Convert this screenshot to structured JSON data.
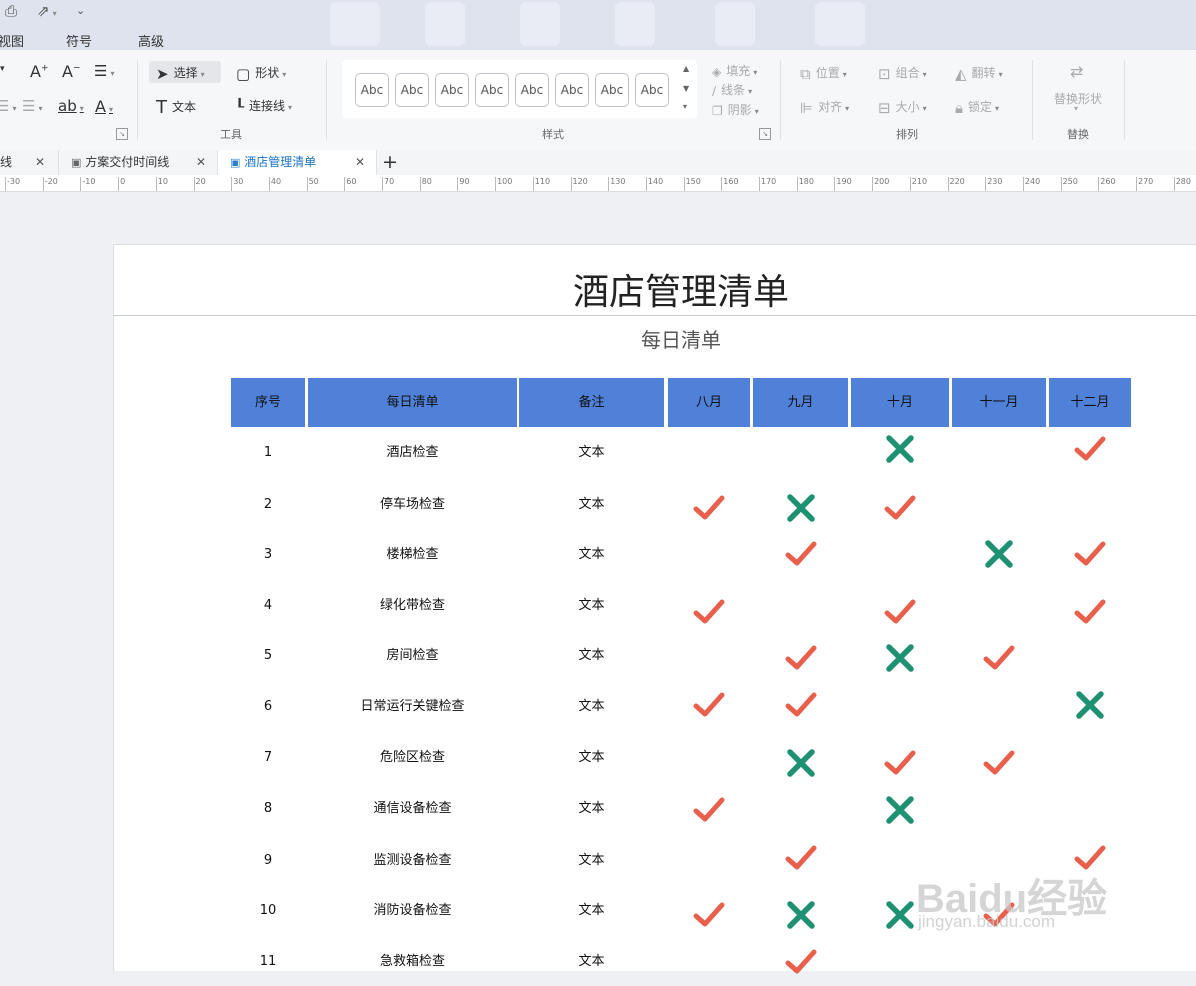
{
  "menu": {
    "view": "视图",
    "symbol": "符号",
    "advanced": "高级"
  },
  "ribbon": {
    "select": "选择",
    "shape": "形状",
    "text": "文本",
    "connector": "连接线",
    "tools_label": "工具",
    "style_sample": "Abc",
    "style_label": "样式",
    "fill": "填充",
    "line": "线条",
    "shadow": "阴影",
    "position": "位置",
    "group": "组合",
    "flip": "翻转",
    "align": "对齐",
    "size": "大小",
    "lock": "锁定",
    "arrange_label": "排列",
    "replace_shape": "替换形状",
    "replace_label": "替换"
  },
  "tabs": [
    {
      "label": "线"
    },
    {
      "label": "方案交付时间线"
    },
    {
      "label": "酒店管理清单",
      "active": true
    }
  ],
  "ruler": [
    "-30",
    "-20",
    "-10",
    "0",
    "10",
    "20",
    "30",
    "40",
    "50",
    "60",
    "70",
    "80",
    "90",
    "100",
    "110",
    "120",
    "130",
    "140",
    "150",
    "160",
    "170",
    "180",
    "190",
    "200",
    "210",
    "220",
    "230",
    "240",
    "250",
    "260",
    "270",
    "280"
  ],
  "doc": {
    "title": "酒店管理清单",
    "subtitle": "每日清单"
  },
  "table": {
    "headers": [
      "序号",
      "每日清单",
      "备注",
      "八月",
      "九月",
      "十月",
      "十一月",
      "十二月"
    ],
    "rows": [
      {
        "no": "1",
        "item": "酒店检查",
        "note": "文本",
        "marks": [
          "",
          "",
          "x",
          "",
          "check"
        ]
      },
      {
        "no": "2",
        "item": "停车场检查",
        "note": "文本",
        "marks": [
          "check",
          "x",
          "check",
          "",
          ""
        ]
      },
      {
        "no": "3",
        "item": "楼梯检查",
        "note": "文本",
        "marks": [
          "",
          "check",
          "",
          "x",
          "check"
        ]
      },
      {
        "no": "4",
        "item": "绿化带检查",
        "note": "文本",
        "marks": [
          "check",
          "",
          "check",
          "",
          "check"
        ]
      },
      {
        "no": "5",
        "item": "房间检查",
        "note": "文本",
        "marks": [
          "",
          "check",
          "x",
          "check",
          ""
        ]
      },
      {
        "no": "6",
        "item": "日常运行关键检查",
        "note": "文本",
        "marks": [
          "check",
          "check",
          "",
          "",
          "x"
        ]
      },
      {
        "no": "7",
        "item": "危险区检查",
        "note": "文本",
        "marks": [
          "",
          "x",
          "check",
          "check",
          ""
        ]
      },
      {
        "no": "8",
        "item": "通信设备检查",
        "note": "文本",
        "marks": [
          "check",
          "",
          "x",
          "",
          ""
        ]
      },
      {
        "no": "9",
        "item": "监测设备检查",
        "note": "文本",
        "marks": [
          "",
          "check",
          "",
          "",
          "check"
        ]
      },
      {
        "no": "10",
        "item": "消防设备检查",
        "note": "文本",
        "marks": [
          "check",
          "x",
          "x",
          "check",
          ""
        ]
      },
      {
        "no": "11",
        "item": "急救箱检查",
        "note": "文本",
        "marks": [
          "",
          "check",
          "",
          "",
          ""
        ]
      }
    ]
  },
  "colors": {
    "header": "#4f81d9",
    "check": "#e8604c",
    "cross": "#1e9173"
  },
  "watermark": {
    "line1": "Baidu经验",
    "line2": "jingyan.baidu.com"
  }
}
